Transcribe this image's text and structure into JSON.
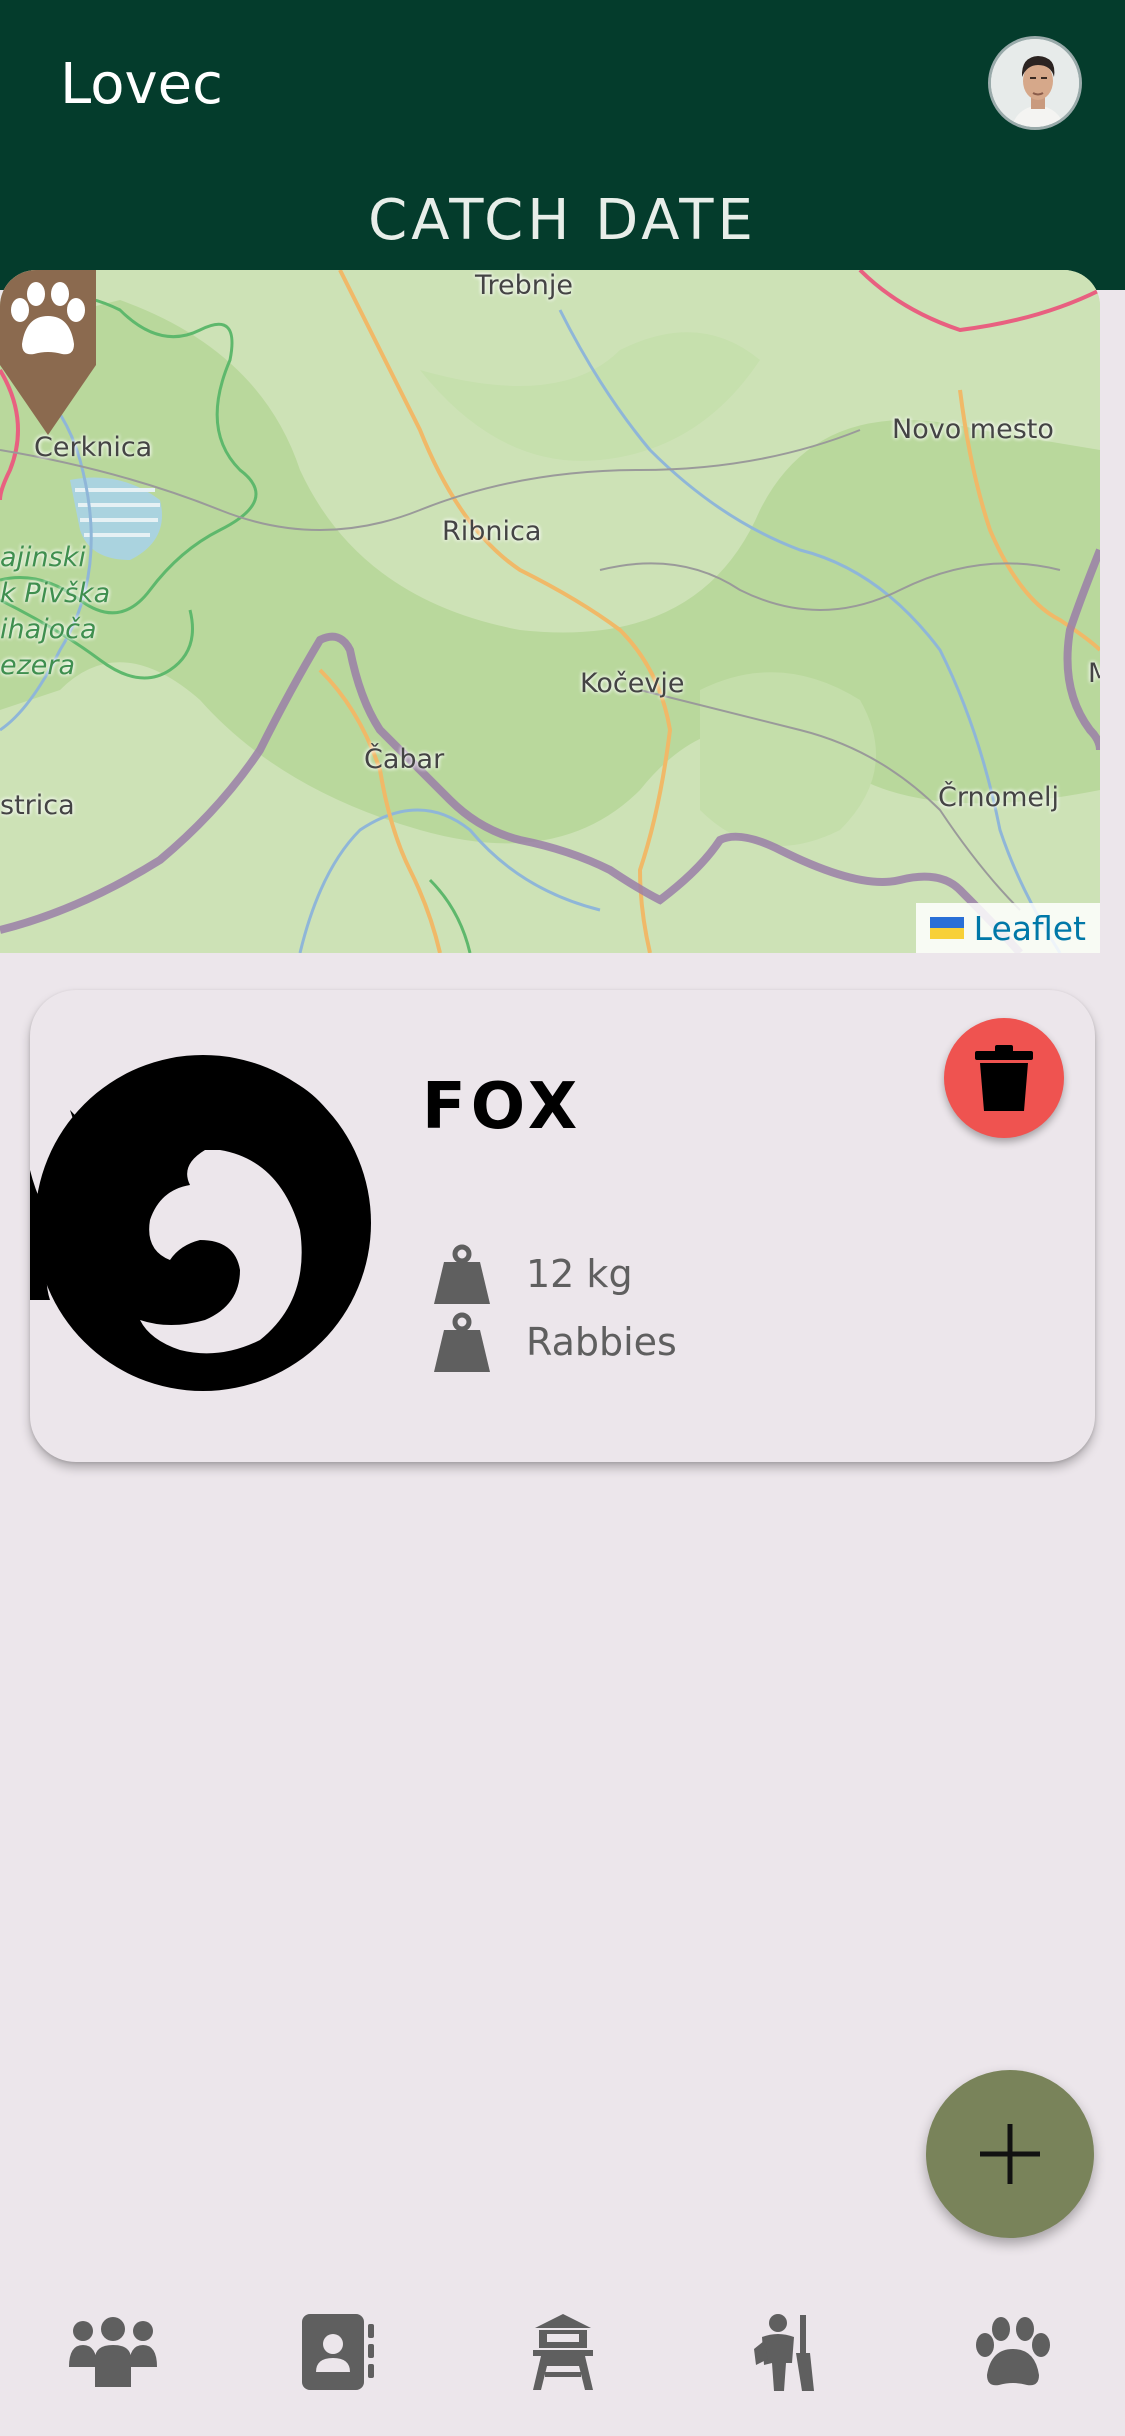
{
  "header": {
    "app_title": "Lovec",
    "page_title": "CATCH DATE",
    "avatar_icon": "user-avatar"
  },
  "map": {
    "labels": [
      "Trebnje",
      "Cerknica",
      "Ribnica",
      "Novo mesto",
      "Kočevje",
      "Čabar",
      "Črnomelj",
      "strica",
      "ajinski",
      "k Pivška",
      "ihajoča",
      "ezera",
      "M"
    ],
    "attribution": "Leaflet",
    "marker_icon": "paw-icon"
  },
  "catch": {
    "name": "FOX",
    "weight": "12 kg",
    "disease": "Rabbies",
    "image_icon": "fox-logo",
    "delete_icon": "trash-icon"
  },
  "fab": {
    "icon": "plus-icon"
  },
  "nav": {
    "items": [
      {
        "icon": "group-icon"
      },
      {
        "icon": "contacts-icon"
      },
      {
        "icon": "hunting-tower-icon"
      },
      {
        "icon": "hunter-icon"
      },
      {
        "icon": "paw-icon"
      }
    ]
  },
  "colors": {
    "header_bg": "#043C2C",
    "page_bg": "#ECE6EB",
    "delete": "#EF5350",
    "fab": "#79835A",
    "marker": "#8B6A4F"
  }
}
